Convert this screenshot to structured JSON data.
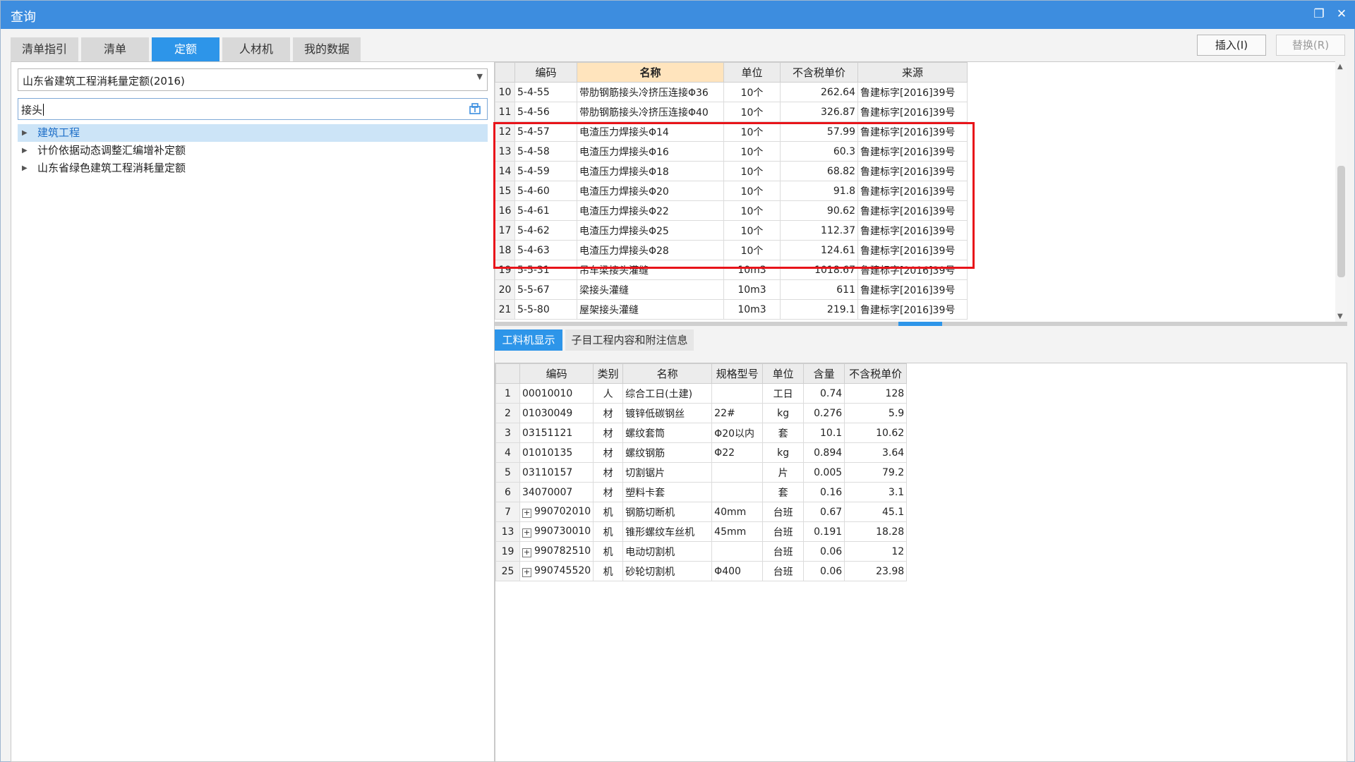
{
  "window": {
    "title": "查询"
  },
  "main_tabs": [
    {
      "label": "清单指引"
    },
    {
      "label": "清单"
    },
    {
      "label": "定额"
    },
    {
      "label": "人材机"
    },
    {
      "label": "我的数据"
    }
  ],
  "active_main_tab": "定额",
  "buttons": {
    "insert": "插入(I)",
    "replace": "替换(R)"
  },
  "left": {
    "library": "山东省建筑工程消耗量定额(2016)",
    "search_value": "接头",
    "tree": [
      {
        "label": "建筑工程",
        "selected": true
      },
      {
        "label": "计价依据动态调整汇编增补定额",
        "selected": false
      },
      {
        "label": "山东省绿色建筑工程消耗量定额",
        "selected": false
      }
    ]
  },
  "upper_grid": {
    "headers": [
      "",
      "编码",
      "名称",
      "单位",
      "不含税单价",
      "来源"
    ],
    "rows": [
      {
        "n": "10",
        "code": "5-4-55",
        "name": "带肋钢筋接头冷挤压连接Φ36",
        "unit": "10个",
        "price": "262.64",
        "source": "鲁建标字[2016]39号"
      },
      {
        "n": "11",
        "code": "5-4-56",
        "name": "带肋钢筋接头冷挤压连接Φ40",
        "unit": "10个",
        "price": "326.87",
        "source": "鲁建标字[2016]39号"
      },
      {
        "n": "12",
        "code": "5-4-57",
        "name": "电渣压力焊接头Φ14",
        "unit": "10个",
        "price": "57.99",
        "source": "鲁建标字[2016]39号"
      },
      {
        "n": "13",
        "code": "5-4-58",
        "name": "电渣压力焊接头Φ16",
        "unit": "10个",
        "price": "60.3",
        "source": "鲁建标字[2016]39号"
      },
      {
        "n": "14",
        "code": "5-4-59",
        "name": "电渣压力焊接头Φ18",
        "unit": "10个",
        "price": "68.82",
        "source": "鲁建标字[2016]39号"
      },
      {
        "n": "15",
        "code": "5-4-60",
        "name": "电渣压力焊接头Φ20",
        "unit": "10个",
        "price": "91.8",
        "source": "鲁建标字[2016]39号"
      },
      {
        "n": "16",
        "code": "5-4-61",
        "name": "电渣压力焊接头Φ22",
        "unit": "10个",
        "price": "90.62",
        "source": "鲁建标字[2016]39号"
      },
      {
        "n": "17",
        "code": "5-4-62",
        "name": "电渣压力焊接头Φ25",
        "unit": "10个",
        "price": "112.37",
        "source": "鲁建标字[2016]39号"
      },
      {
        "n": "18",
        "code": "5-4-63",
        "name": "电渣压力焊接头Φ28",
        "unit": "10个",
        "price": "124.61",
        "source": "鲁建标字[2016]39号"
      },
      {
        "n": "19",
        "code": "5-5-31",
        "name": "吊车梁接头灌缝",
        "unit": "10m3",
        "price": "1018.67",
        "source": "鲁建标字[2016]39号"
      },
      {
        "n": "20",
        "code": "5-5-67",
        "name": "梁接头灌缝",
        "unit": "10m3",
        "price": "611",
        "source": "鲁建标字[2016]39号"
      },
      {
        "n": "21",
        "code": "5-5-80",
        "name": "屋架接头灌缝",
        "unit": "10m3",
        "price": "219.1",
        "source": "鲁建标字[2016]39号"
      }
    ]
  },
  "sub_tabs": [
    {
      "label": "工料机显示"
    },
    {
      "label": "子目工程内容和附注信息"
    }
  ],
  "lower_grid": {
    "headers": [
      "",
      "编码",
      "类别",
      "名称",
      "规格型号",
      "单位",
      "含量",
      "不含税单价"
    ],
    "rows": [
      {
        "n": "1",
        "expand": false,
        "code": "00010010",
        "cat": "人",
        "name": "综合工日(土建)",
        "spec": "",
        "unit": "工日",
        "qty": "0.74",
        "price": "128"
      },
      {
        "n": "2",
        "expand": false,
        "code": "01030049",
        "cat": "材",
        "name": "镀锌低碳钢丝",
        "spec": "22#",
        "unit": "kg",
        "qty": "0.276",
        "price": "5.9"
      },
      {
        "n": "3",
        "expand": false,
        "code": "03151121",
        "cat": "材",
        "name": "螺纹套筒",
        "spec": "Φ20以内",
        "unit": "套",
        "qty": "10.1",
        "price": "10.62"
      },
      {
        "n": "4",
        "expand": false,
        "code": "01010135",
        "cat": "材",
        "name": "螺纹钢筋",
        "spec": "Φ22",
        "unit": "kg",
        "qty": "0.894",
        "price": "3.64"
      },
      {
        "n": "5",
        "expand": false,
        "code": "03110157",
        "cat": "材",
        "name": "切割锯片",
        "spec": "",
        "unit": "片",
        "qty": "0.005",
        "price": "79.2"
      },
      {
        "n": "6",
        "expand": false,
        "code": "34070007",
        "cat": "材",
        "name": "塑料卡套",
        "spec": "",
        "unit": "套",
        "qty": "0.16",
        "price": "3.1"
      },
      {
        "n": "7",
        "expand": true,
        "code": "990702010",
        "cat": "机",
        "name": "钢筋切断机",
        "spec": "40mm",
        "unit": "台班",
        "qty": "0.67",
        "price": "45.1"
      },
      {
        "n": "13",
        "expand": true,
        "code": "990730010",
        "cat": "机",
        "name": "锥形螺纹车丝机",
        "spec": "45mm",
        "unit": "台班",
        "qty": "0.191",
        "price": "18.28"
      },
      {
        "n": "19",
        "expand": true,
        "code": "990782510",
        "cat": "机",
        "name": "电动切割机",
        "spec": "",
        "unit": "台班",
        "qty": "0.06",
        "price": "12"
      },
      {
        "n": "25",
        "expand": true,
        "code": "990745520",
        "cat": "机",
        "name": "砂轮切割机",
        "spec": "Φ400",
        "unit": "台班",
        "qty": "0.06",
        "price": "23.98"
      }
    ]
  },
  "colors": {
    "titlebar": "#3d8ddf",
    "accent": "#2d95e9",
    "highlight": "#e8141a",
    "selected_header": "#ffe4bd"
  },
  "icons": {
    "restore": "restore-icon",
    "close": "close-icon",
    "search_lib": "library-search-icon"
  }
}
